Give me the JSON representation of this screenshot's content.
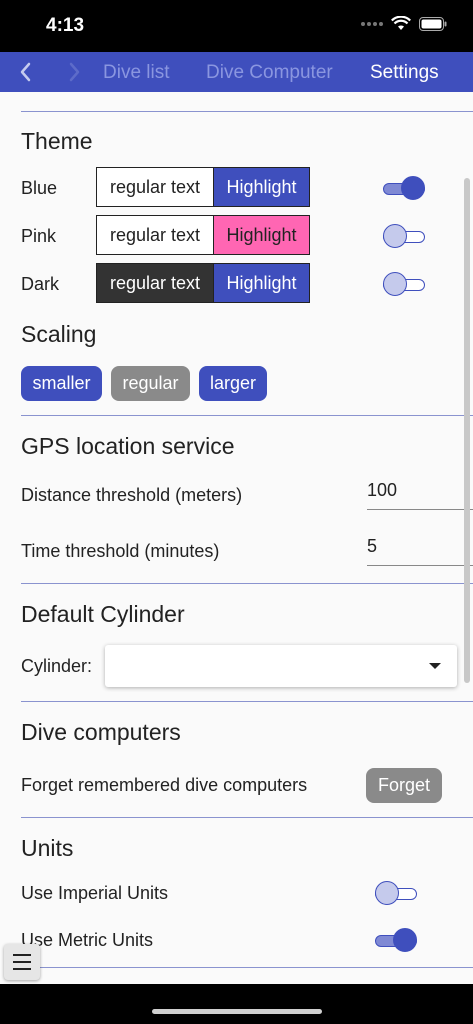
{
  "status_bar": {
    "time": "4:13"
  },
  "nav": {
    "tabs": [
      {
        "label": "Dive list"
      },
      {
        "label": "Dive Computer"
      },
      {
        "label": "Settings"
      }
    ]
  },
  "theme": {
    "title": "Theme",
    "rows": [
      {
        "name": "Blue",
        "regular": "regular text",
        "highlight": "Highlight",
        "enabled": true
      },
      {
        "name": "Pink",
        "regular": "regular text",
        "highlight": "Highlight",
        "enabled": false
      },
      {
        "name": "Dark",
        "regular": "regular text",
        "highlight": "Highlight",
        "enabled": false
      }
    ]
  },
  "scaling": {
    "title": "Scaling",
    "options": [
      "smaller",
      "regular",
      "larger"
    ],
    "selected": "regular"
  },
  "gps": {
    "title": "GPS location service",
    "distance_label": "Distance threshold (meters)",
    "distance_value": "100",
    "time_label": "Time threshold (minutes)",
    "time_value": "5"
  },
  "cylinder": {
    "title": "Default Cylinder",
    "label": "Cylinder:",
    "value": ""
  },
  "dive_computers": {
    "title": "Dive computers",
    "forget_label": "Forget remembered dive computers",
    "forget_button": "Forget"
  },
  "units": {
    "title": "Units",
    "imperial_label": "Use Imperial Units",
    "imperial_on": false,
    "metric_label": "Use Metric Units",
    "metric_on": true
  },
  "colors": {
    "primary": "#3f4fbd",
    "pink": "#ff66b3",
    "dark": "#333333",
    "disabled_button": "#8a8a8a"
  }
}
